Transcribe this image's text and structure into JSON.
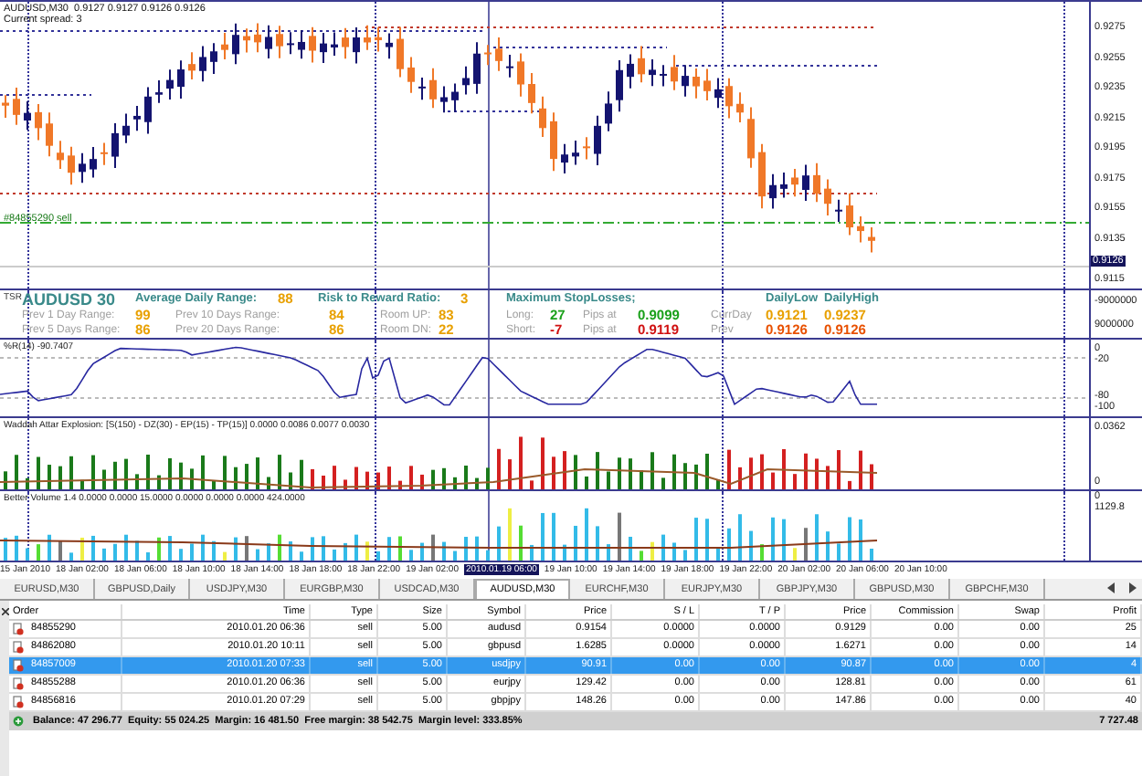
{
  "chart": {
    "title": "AUDUSD,M30  0.9127 0.9127 0.9126 0.9126",
    "spread": "Current spread: 3",
    "order_label": "#84855290 sell",
    "price_axis": [
      "0.9275",
      "0.9255",
      "0.9235",
      "0.9215",
      "0.9195",
      "0.9175",
      "0.9155",
      "0.9135"
    ],
    "current_price": "0.9126",
    "low_tick": "0.9115"
  },
  "info_panel": {
    "tag": "TSR",
    "axis": [
      "-9000000",
      "9000000"
    ],
    "header": [
      {
        "text": "AUDUSD 30",
        "kind": "symbol"
      },
      {
        "text": "Average Daily Range:",
        "kind": "heading"
      },
      {
        "text": "88",
        "kind": "value",
        "color": "#e8a000"
      },
      {
        "text": "Risk to Reward Ratio:",
        "kind": "heading"
      },
      {
        "text": "3",
        "kind": "value",
        "color": "#e8a000"
      },
      {
        "text": "Maximum StopLosses;",
        "kind": "heading"
      },
      {
        "text": "DailyLow",
        "kind": "heading"
      },
      {
        "text": "DailyHigh",
        "kind": "heading"
      }
    ],
    "rows": [
      [
        {
          "text": "Prev 1 Day Range:",
          "kind": "label"
        },
        {
          "text": "99",
          "kind": "value",
          "color": "#e8a000"
        },
        {
          "text": "Prev 10 Days Range:",
          "kind": "label"
        },
        {
          "text": "84",
          "kind": "value",
          "color": "#e8a000"
        },
        {
          "text": "Room UP:",
          "kind": "label"
        },
        {
          "text": "83",
          "kind": "value",
          "color": "#e8a000"
        },
        {
          "text": "Long:",
          "kind": "label"
        },
        {
          "text": "27",
          "kind": "value",
          "color": "#1aa01a"
        },
        {
          "text": "Pips at",
          "kind": "label"
        },
        {
          "text": "0.9099",
          "kind": "value",
          "color": "#1aa01a"
        },
        {
          "text": "CurrDay",
          "kind": "label"
        },
        {
          "text": "0.9121",
          "kind": "value",
          "color": "#e8a000"
        },
        {
          "text": "0.9237",
          "kind": "value",
          "color": "#e8a000"
        }
      ],
      [
        {
          "text": "Prev 5 Days Range:",
          "kind": "label"
        },
        {
          "text": "86",
          "kind": "value",
          "color": "#e8a000"
        },
        {
          "text": "Prev 20 Days Range:",
          "kind": "label"
        },
        {
          "text": "86",
          "kind": "value",
          "color": "#e8a000"
        },
        {
          "text": "Room DN:",
          "kind": "label"
        },
        {
          "text": "22",
          "kind": "value",
          "color": "#e8a000"
        },
        {
          "text": "Short:",
          "kind": "label"
        },
        {
          "text": "-7",
          "kind": "value",
          "color": "#d01010"
        },
        {
          "text": "Pips at",
          "kind": "label"
        },
        {
          "text": "0.9119",
          "kind": "value",
          "color": "#d01010"
        },
        {
          "text": "Prev",
          "kind": "label"
        },
        {
          "text": "0.9126",
          "kind": "value",
          "color": "#e85000"
        },
        {
          "text": "0.9126",
          "kind": "value",
          "color": "#e85000"
        }
      ]
    ]
  },
  "wpr": {
    "title": "%R(14) -90.7407",
    "axis": [
      "0",
      "-20",
      "-80",
      "-100"
    ]
  },
  "waddah": {
    "title": "Waddah Attar Explosion: [S(150) - DZ(30) - EP(15) - TP(15)] 0.0000 0.0086 0.0077 0.0030",
    "axis": [
      "0.0362",
      "0"
    ]
  },
  "volume": {
    "title": "Better Volume 1.4 0.0000 0.0000 15.0000 0.0000 0.0000 0.0000 424.0000",
    "axis": [
      "0",
      "1129.8"
    ]
  },
  "time_axis": [
    {
      "label": "15 Jan 2010",
      "selected": false
    },
    {
      "label": "18 Jan 02:00",
      "selected": false
    },
    {
      "label": "18 Jan 06:00",
      "selected": false
    },
    {
      "label": "18 Jan 10:00",
      "selected": false
    },
    {
      "label": "18 Jan 14:00",
      "selected": false
    },
    {
      "label": "18 Jan 18:00",
      "selected": false
    },
    {
      "label": "18 Jan 22:00",
      "selected": false
    },
    {
      "label": "19 Jan 02:00",
      "selected": false
    },
    {
      "label": "2010.01.19 06:00",
      "selected": true
    },
    {
      "label": "19 Jan 10:00",
      "selected": false
    },
    {
      "label": "19 Jan 14:00",
      "selected": false
    },
    {
      "label": "19 Jan 18:00",
      "selected": false
    },
    {
      "label": "19 Jan 22:00",
      "selected": false
    },
    {
      "label": "20 Jan 02:00",
      "selected": false
    },
    {
      "label": "20 Jan 06:00",
      "selected": false
    },
    {
      "label": "20 Jan 10:00",
      "selected": false
    }
  ],
  "tabs": [
    {
      "label": "EURUSD,M30",
      "selected": false
    },
    {
      "label": "GBPUSD,Daily",
      "selected": false
    },
    {
      "label": "USDJPY,M30",
      "selected": false
    },
    {
      "label": "EURGBP,M30",
      "selected": false
    },
    {
      "label": "USDCAD,M30",
      "selected": false
    },
    {
      "label": "AUDUSD,M30",
      "selected": true
    },
    {
      "label": "EURCHF,M30",
      "selected": false
    },
    {
      "label": "EURJPY,M30",
      "selected": false
    },
    {
      "label": "GBPJPY,M30",
      "selected": false
    },
    {
      "label": "GBPUSD,M30",
      "selected": false
    },
    {
      "label": "GBPCHF,M30",
      "selected": false
    }
  ],
  "table": {
    "columns": [
      "Order",
      "Time",
      "Type",
      "Size",
      "Symbol",
      "Price",
      "S / L",
      "T / P",
      "Price",
      "Commission",
      "Swap",
      "Profit"
    ],
    "rows": [
      {
        "selected": false,
        "cells": [
          "84855290",
          "2010.01.20 06:36",
          "sell",
          "5.00",
          "audusd",
          "0.9154",
          "0.0000",
          "0.0000",
          "0.9129",
          "0.00",
          "0.00",
          "25"
        ]
      },
      {
        "selected": false,
        "cells": [
          "84862080",
          "2010.01.20 10:11",
          "sell",
          "5.00",
          "gbpusd",
          "1.6285",
          "0.0000",
          "0.0000",
          "1.6271",
          "0.00",
          "0.00",
          "14"
        ]
      },
      {
        "selected": true,
        "cells": [
          "84857009",
          "2010.01.20 07:33",
          "sell",
          "5.00",
          "usdjpy",
          "90.91",
          "0.00",
          "0.00",
          "90.87",
          "0.00",
          "0.00",
          "4"
        ]
      },
      {
        "selected": false,
        "cells": [
          "84855288",
          "2010.01.20 06:36",
          "sell",
          "5.00",
          "eurjpy",
          "129.42",
          "0.00",
          "0.00",
          "128.81",
          "0.00",
          "0.00",
          "61"
        ]
      },
      {
        "selected": false,
        "cells": [
          "84856816",
          "2010.01.20 07:29",
          "sell",
          "5.00",
          "gbpjpy",
          "148.26",
          "0.00",
          "0.00",
          "147.86",
          "0.00",
          "0.00",
          "40"
        ]
      }
    ],
    "balance": "Balance: 47 296.77  Equity: 55 024.25  Margin: 16 481.50  Free margin: 38 542.75  Margin level: 333.85%",
    "total": "7 727.48"
  }
}
